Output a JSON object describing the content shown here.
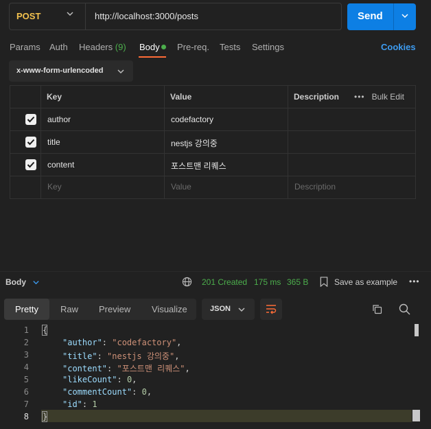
{
  "request": {
    "method": "POST",
    "url": "http://localhost:3000/posts",
    "send_label": "Send"
  },
  "tabs": {
    "params": "Params",
    "auth": "Auth",
    "headers": "Headers",
    "headers_count": "(9)",
    "body": "Body",
    "prereq": "Pre-req.",
    "tests": "Tests",
    "settings": "Settings",
    "cookies": "Cookies"
  },
  "body_type": "x-www-form-urlencoded",
  "table": {
    "headers": {
      "key": "Key",
      "value": "Value",
      "description": "Description",
      "bulk_edit": "Bulk Edit"
    },
    "rows": [
      {
        "key": "author",
        "value": "codefactory",
        "checked": true
      },
      {
        "key": "title",
        "value": "nestjs 강의중",
        "checked": true
      },
      {
        "key": "content",
        "value": "포스트맨 리퀘스",
        "checked": true
      }
    ],
    "placeholders": {
      "key": "Key",
      "value": "Value",
      "description": "Description"
    }
  },
  "response": {
    "body_label": "Body",
    "status": "201 Created",
    "time": "175 ms",
    "size": "365 B",
    "save_label": "Save as example",
    "more": "•••",
    "view_tabs": [
      "Pretty",
      "Raw",
      "Preview",
      "Visualize"
    ],
    "active_view": "Pretty",
    "format": "JSON"
  },
  "code": {
    "line_numbers": [
      "1",
      "2",
      "3",
      "4",
      "5",
      "6",
      "7",
      "8"
    ],
    "open": "{",
    "close": "}",
    "fields": [
      {
        "key": "\"author\"",
        "value": "\"codefactory\"",
        "type": "str"
      },
      {
        "key": "\"title\"",
        "value": "\"nestjs 강의중\"",
        "type": "str"
      },
      {
        "key": "\"content\"",
        "value": "\"포스트맨 리퀘스\"",
        "type": "str"
      },
      {
        "key": "\"likeCount\"",
        "value": "0",
        "type": "num"
      },
      {
        "key": "\"commentCount\"",
        "value": "0",
        "type": "num"
      },
      {
        "key": "\"id\"",
        "value": "1",
        "type": "num"
      }
    ]
  },
  "colors": {
    "accent": "#ff6c37",
    "send": "#0d7fe4",
    "success": "#4cae4c",
    "method": "#f2c14e"
  },
  "icons": {
    "method_dropdown": "chevron-down-icon",
    "send_dropdown": "chevron-down-icon",
    "globe": "globe-icon",
    "save": "save-icon",
    "wrap": "wrap-lines-icon",
    "copy": "copy-icon",
    "search": "search-icon",
    "checkbox": "check-icon"
  }
}
